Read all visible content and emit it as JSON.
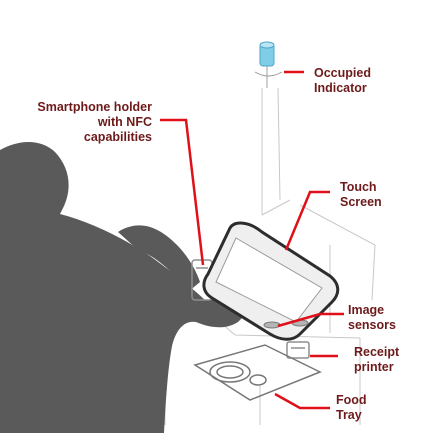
{
  "colors": {
    "label_text": "#6e1a1a",
    "callout": "#e0101a",
    "silhouette": "#5a5a5a",
    "sketch": "#8f8f8f",
    "indicator": "#7fcde6"
  },
  "labels": {
    "occupied_indicator": "Occupied\nIndicator",
    "smartphone_holder": "Smartphone holder\nwith NFC\ncapabilities",
    "touch_screen": "Touch\nScreen",
    "image_sensors": "Image\nsensors",
    "receipt_printer": "Receipt\nprinter",
    "food_tray": "Food\nTray"
  },
  "icons": {
    "person": "person-silhouette",
    "indicator": "occupied-light-icon",
    "phone_holder": "phone-holder-icon",
    "screen": "touch-screen-icon",
    "sensor": "image-sensor-icon",
    "printer": "receipt-printer-icon",
    "tray": "food-tray-icon"
  }
}
